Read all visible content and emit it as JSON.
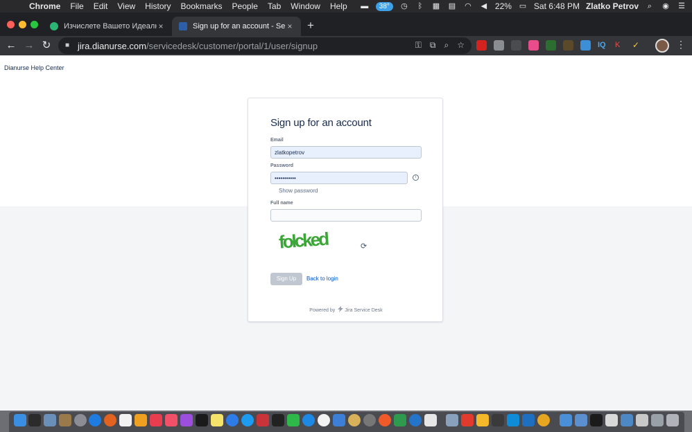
{
  "menubar": {
    "app": "Chrome",
    "menus": [
      "File",
      "Edit",
      "View",
      "History",
      "Bookmarks",
      "People",
      "Tab",
      "Window",
      "Help"
    ],
    "weather": "38°",
    "battery": "22%",
    "clock": "Sat 6:48 PM",
    "user": "Zlatko Petrov"
  },
  "tabs": [
    {
      "title": "Изчислете Вашето Идеално Те",
      "active": false
    },
    {
      "title": "Sign up for an account - Service",
      "active": true
    }
  ],
  "address": {
    "host": "jira.dianurse.com",
    "path": "/servicedesk/customer/portal/1/user/signup"
  },
  "page": {
    "help_center": "Dianurse Help Center"
  },
  "form": {
    "title": "Sign up for an account",
    "email_label": "Email",
    "email_value": "zlatkopetrov",
    "password_label": "Password",
    "password_value": "•••••••••••",
    "show_password": "Show password",
    "fullname_label": "Full name",
    "fullname_value": "",
    "captcha_text": "folcked",
    "signup_label": "Sign Up",
    "back_label": "Back to login",
    "powered_prefix": "Powered by",
    "powered_brand": "Jira Service Desk"
  },
  "colors": {
    "link": "#0052cc",
    "title": "#172b4d",
    "captcha": "#3aa635",
    "button_disabled": "#c1c7d0"
  }
}
